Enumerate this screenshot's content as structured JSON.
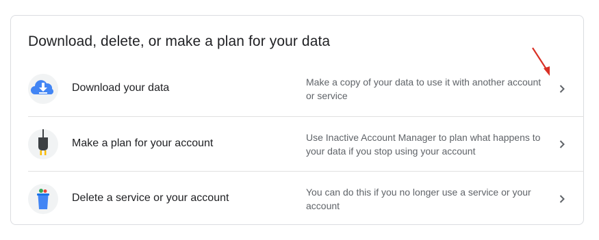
{
  "card": {
    "title": "Download, delete, or make a plan for your data",
    "items": [
      {
        "label": "Download your data",
        "description": "Make a copy of your data to use it with another account or service",
        "icon": "cloud-download-icon"
      },
      {
        "label": "Make a plan for your account",
        "description": "Use Inactive Account Manager to plan what happens to your data if you stop using your account",
        "icon": "power-plug-icon"
      },
      {
        "label": "Delete a service or your account",
        "description": "You can do this if you no longer use a service or your account",
        "icon": "trash-can-icon"
      }
    ]
  },
  "colors": {
    "title_text": "#202124",
    "secondary_text": "#5f6368",
    "divider": "#e0e0e0",
    "annotation_arrow": "#d93025"
  }
}
